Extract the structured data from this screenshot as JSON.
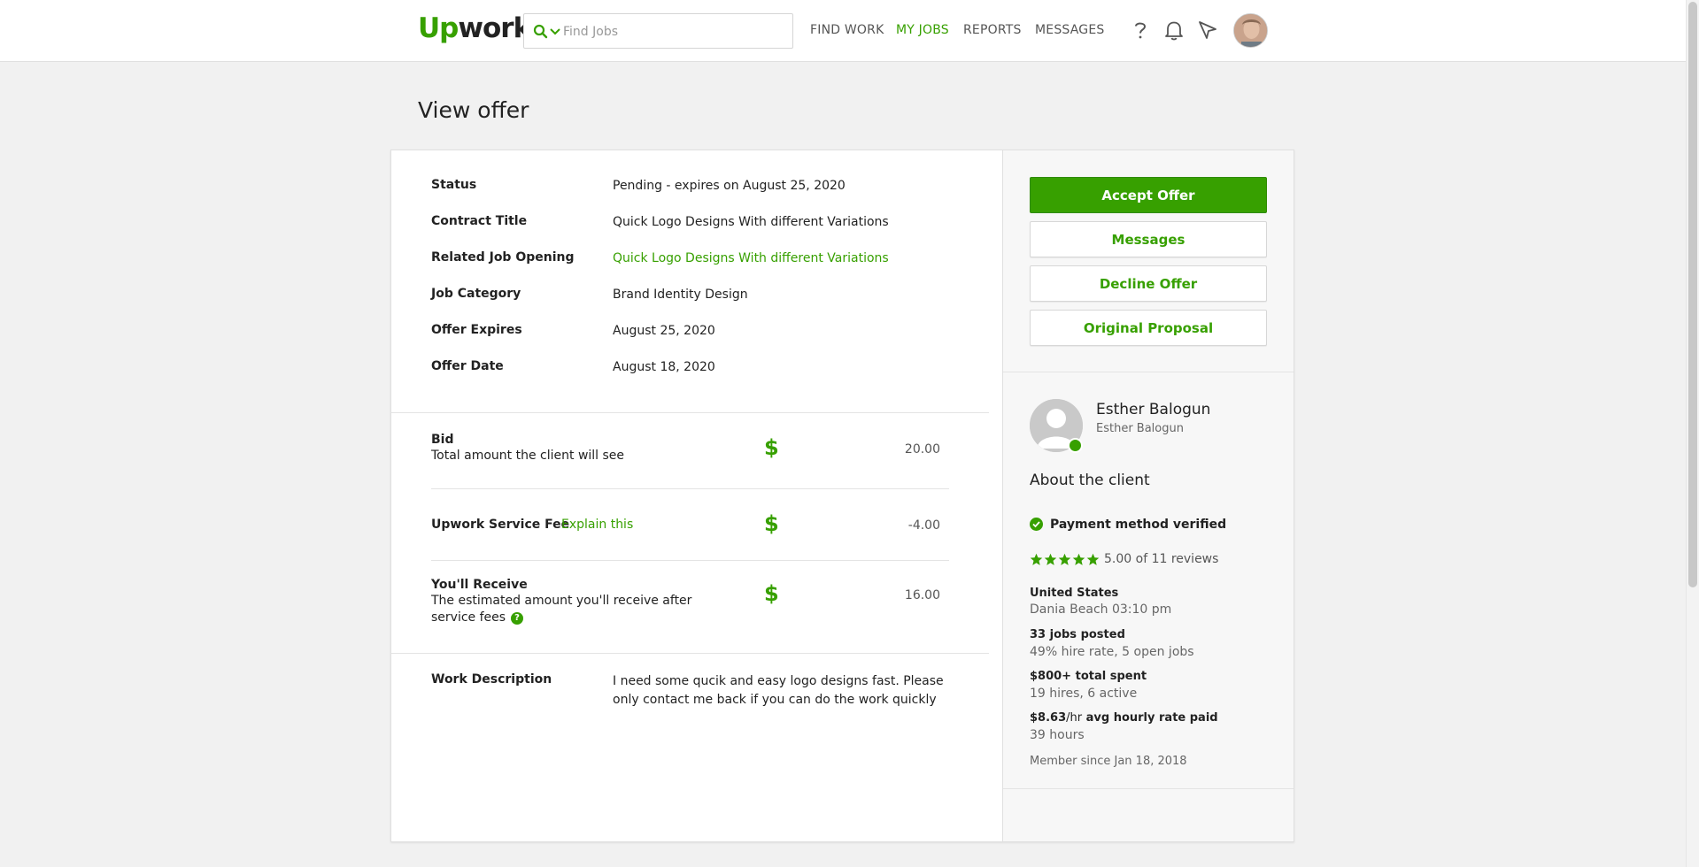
{
  "header": {
    "logo_up": "Up",
    "logo_work": "work",
    "search_placeholder": "Find Jobs",
    "nav": [
      {
        "label": "FIND WORK"
      },
      {
        "label": "MY JOBS"
      },
      {
        "label": "REPORTS"
      },
      {
        "label": "MESSAGES"
      }
    ],
    "active_nav": "MY JOBS",
    "icons": [
      "search-icon",
      "chevron-down-icon",
      "help-icon",
      "bell-icon",
      "send-icon",
      "avatar"
    ]
  },
  "page": {
    "title": "View offer"
  },
  "offer": {
    "fields": [
      {
        "label": "Status",
        "value": "Pending - expires on August 25, 2020"
      },
      {
        "label": "Contract Title",
        "value": "Quick Logo Designs With different Variations"
      },
      {
        "label": "Related Job Opening",
        "value": "Quick Logo Designs With different Variations"
      },
      {
        "label": "Job Category",
        "value": "Brand Identity Design"
      },
      {
        "label": "Offer Expires",
        "value": "August 25, 2020"
      },
      {
        "label": "Offer Date",
        "value": "August 18, 2020"
      }
    ],
    "bid": {
      "label": "Bid",
      "sub": "Total amount the client will see",
      "currency": "$",
      "amount": "20.00"
    },
    "fee": {
      "label": "Upwork Service Fee",
      "link": "Explain this",
      "currency": "$",
      "amount": "-4.00"
    },
    "receive": {
      "label": "You'll Receive",
      "sub_line1": "The estimated amount you'll receive after",
      "sub_line2": "service fees",
      "help": "?",
      "currency": "$",
      "amount": "16.00"
    },
    "description": {
      "label": "Work Description",
      "text": "I need some qucik and easy logo designs fast. Please only contact me back if you can do the work quickly"
    }
  },
  "actions": {
    "accept": "Accept Offer",
    "messages": "Messages",
    "decline": "Decline Offer",
    "proposal": "Original Proposal"
  },
  "client": {
    "name": "Esther Balogun",
    "subname": "Esther Balogun",
    "about_title": "About the client",
    "verified": "Payment method verified",
    "rating_text": "5.00 of 11 reviews",
    "stars": 5,
    "country": "United States",
    "location_time": "Dania Beach 03:10 pm",
    "jobs_posted": "33 jobs posted",
    "jobs_detail": "49% hire rate, 5 open jobs",
    "total_spent": "$800+ total spent",
    "spent_detail": "19 hires, 6 active",
    "rate_value": "$8.63",
    "rate_unit": "/hr",
    "rate_label": "avg hourly rate paid",
    "hours": "39 hours",
    "member_since": "Member since Jan 18, 2018"
  },
  "colors": {
    "brand_green": "#37a000",
    "background": "#f1f1f1",
    "panel": "#f7f7f7"
  }
}
